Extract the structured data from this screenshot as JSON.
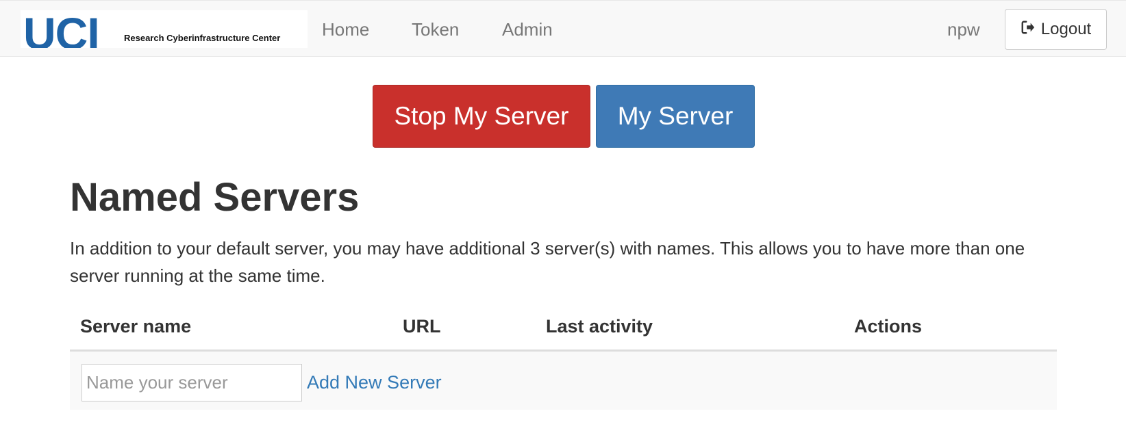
{
  "navbar": {
    "logo": {
      "wordmark": "UCI",
      "subtitle": "Research Cyberinfrastructure Center"
    },
    "links": [
      {
        "label": "Home"
      },
      {
        "label": "Token"
      },
      {
        "label": "Admin"
      }
    ],
    "username": "npw",
    "logout_label": "Logout",
    "logout_icon": "sign-out-icon"
  },
  "server_buttons": {
    "stop_label": "Stop My Server",
    "my_server_label": "My Server"
  },
  "named_servers": {
    "title": "Named Servers",
    "description": "In addition to your default server, you may have additional 3 server(s) with names. This allows you to have more than one server running at the same time.",
    "columns": [
      "Server name",
      "URL",
      "Last activity",
      "Actions"
    ],
    "new_server": {
      "placeholder": "Name your server",
      "value": "",
      "add_label": "Add New Server"
    }
  },
  "colors": {
    "brand_blue": "#1f63a6",
    "danger": "#c9302c",
    "primary": "#3f7ab6",
    "link": "#337ab7"
  }
}
